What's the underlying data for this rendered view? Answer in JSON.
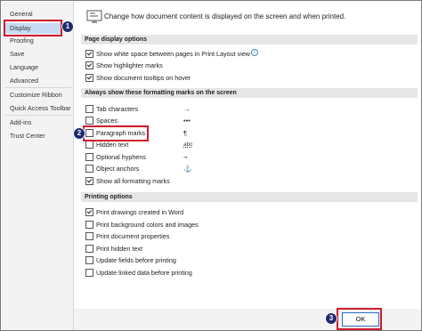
{
  "sidebar": {
    "items": [
      {
        "label": "General"
      },
      {
        "label": "Display"
      },
      {
        "label": "Proofing"
      },
      {
        "label": "Save"
      },
      {
        "label": "Language"
      },
      {
        "label": "Advanced"
      },
      {
        "label": "Customize Ribbon"
      },
      {
        "label": "Quick Access Toolbar"
      },
      {
        "label": "Add-ins"
      },
      {
        "label": "Trust Center"
      }
    ],
    "selected": "Display"
  },
  "callouts": {
    "one": "1",
    "two": "2",
    "three": "3",
    "color": "#d11a2a",
    "badge_color": "#1f2b6e"
  },
  "header": {
    "text": "Change how document content is displayed on the screen and when printed."
  },
  "page_display": {
    "heading": "Page display options",
    "options": [
      {
        "label": "Show white space between pages in Print Layout view",
        "checked": true
      },
      {
        "label": "Show highlighter marks",
        "checked": true
      },
      {
        "label": "Show document tooltips on hover",
        "checked": true
      }
    ]
  },
  "formatting_marks": {
    "heading": "Always show these formatting marks on the screen",
    "options": [
      {
        "label": "Tab characters",
        "symbol": "→",
        "checked": false
      },
      {
        "label": "Spaces",
        "symbol": "•••",
        "checked": false
      },
      {
        "label": "Paragraph marks",
        "symbol": "¶",
        "checked": false
      },
      {
        "label": "Hidden text",
        "symbol": "abc",
        "checked": false
      },
      {
        "label": "Optional hyphens",
        "symbol": "¬",
        "checked": false
      },
      {
        "label": "Object anchors",
        "symbol": "⚓",
        "checked": false
      },
      {
        "label": "Show all formatting marks",
        "symbol": "",
        "checked": true
      }
    ]
  },
  "printing": {
    "heading": "Printing options",
    "options": [
      {
        "label": "Print drawings created in Word",
        "checked": true
      },
      {
        "label": "Print background colors and images",
        "checked": false
      },
      {
        "label": "Print document properties",
        "checked": false
      },
      {
        "label": "Print hidden text",
        "checked": false
      },
      {
        "label": "Update fields before printing",
        "checked": false
      },
      {
        "label": "Update linked data before printing",
        "checked": false
      }
    ]
  },
  "footer": {
    "ok_label": "OK"
  }
}
